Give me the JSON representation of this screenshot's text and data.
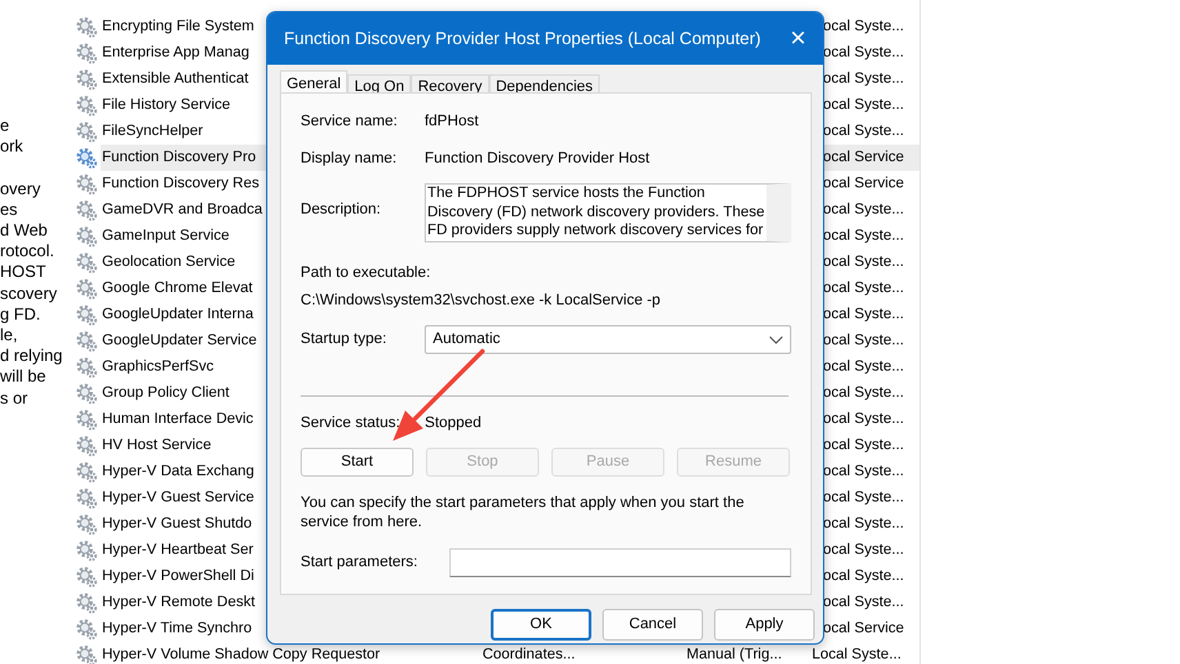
{
  "description_fragment": {
    "paragraphs": [
      [
        "e",
        "ork"
      ],
      [
        "overy",
        "es",
        "d Web",
        "rotocol.",
        "HOST",
        "scovery",
        "g FD.",
        "le,",
        "d relying",
        "will be",
        "s or"
      ]
    ]
  },
  "services": [
    {
      "name": "Encrypting File System",
      "log_on": "ocal Syste...",
      "selected": false
    },
    {
      "name": "Enterprise App Manag",
      "log_on": "ocal Syste...",
      "selected": false
    },
    {
      "name": "Extensible Authenticat",
      "log_on": "ocal Syste...",
      "selected": false
    },
    {
      "name": "File History Service",
      "log_on": "ocal Syste...",
      "selected": false
    },
    {
      "name": "FileSyncHelper",
      "log_on": "ocal Syste...",
      "selected": false
    },
    {
      "name": "Function Discovery Pro",
      "log_on": "ocal Service",
      "selected": true
    },
    {
      "name": "Function Discovery Res",
      "log_on": "ocal Service",
      "selected": false
    },
    {
      "name": "GameDVR and Broadca",
      "log_on": "ocal Syste...",
      "selected": false
    },
    {
      "name": "GameInput Service",
      "log_on": "ocal Syste...",
      "selected": false
    },
    {
      "name": "Geolocation Service",
      "log_on": "ocal Syste...",
      "selected": false
    },
    {
      "name": "Google Chrome Elevat",
      "log_on": "ocal Syste...",
      "selected": false
    },
    {
      "name": "GoogleUpdater Interna",
      "log_on": "ocal Syste...",
      "selected": false
    },
    {
      "name": "GoogleUpdater Service",
      "log_on": "ocal Syste...",
      "selected": false
    },
    {
      "name": "GraphicsPerfSvc",
      "log_on": "ocal Syste...",
      "selected": false
    },
    {
      "name": "Group Policy Client",
      "log_on": "ocal Syste...",
      "selected": false
    },
    {
      "name": "Human Interface Devic",
      "log_on": "ocal Syste...",
      "selected": false
    },
    {
      "name": "HV Host Service",
      "log_on": "ocal Syste...",
      "selected": false
    },
    {
      "name": "Hyper-V Data Exchang",
      "log_on": "ocal Syste...",
      "selected": false
    },
    {
      "name": "Hyper-V Guest Service",
      "log_on": "ocal Syste...",
      "selected": false
    },
    {
      "name": "Hyper-V Guest Shutdo",
      "log_on": "ocal Syste...",
      "selected": false
    },
    {
      "name": "Hyper-V Heartbeat Ser",
      "log_on": "ocal Syste...",
      "selected": false
    },
    {
      "name": "Hyper-V PowerShell Di",
      "log_on": "ocal Syste...",
      "selected": false
    },
    {
      "name": "Hyper-V Remote Deskt",
      "log_on": "ocal Syste...",
      "selected": false
    },
    {
      "name": "Hyper-V Time Synchro",
      "log_on": "ocal Service",
      "selected": false
    },
    {
      "name": "Hyper-V Volume Shadow Copy Requestor",
      "description": "Coordinates...",
      "startup_type": "Manual (Trig...",
      "log_on": "Local Syste...",
      "selected": false
    }
  ],
  "dialog": {
    "title": "Function Discovery Provider Host Properties (Local Computer)",
    "close": "×",
    "tabs": [
      {
        "label": "General",
        "selected": true
      },
      {
        "label": "Log On",
        "selected": false
      },
      {
        "label": "Recovery",
        "selected": false
      },
      {
        "label": "Dependencies",
        "selected": false
      }
    ],
    "service_name": {
      "label": "Service name:",
      "value": "fdPHost"
    },
    "display_name": {
      "label": "Display name:",
      "value": "Function Discovery Provider Host"
    },
    "description": {
      "label": "Description:",
      "lines": [
        "The FDPHOST service hosts the Function",
        "Discovery (FD) network discovery providers. These",
        "FD providers supply network discovery services for"
      ]
    },
    "path": {
      "label": "Path to executable:",
      "value": "C:\\Windows\\system32\\svchost.exe -k LocalService -p"
    },
    "startup_type": {
      "label": "Startup type:",
      "value": "Automatic"
    },
    "service_status": {
      "label": "Service status:",
      "value": "Stopped"
    },
    "control_buttons": [
      {
        "label": "Start",
        "disabled": false
      },
      {
        "label": "Stop",
        "disabled": true
      },
      {
        "label": "Pause",
        "disabled": true
      },
      {
        "label": "Resume",
        "disabled": true
      }
    ],
    "hint": "You can specify the start parameters that apply when you start the service from here.",
    "start_parameters": {
      "label": "Start parameters:"
    },
    "buttons": [
      {
        "label": "OK",
        "default": true
      },
      {
        "label": "Cancel",
        "default": false
      },
      {
        "label": "Apply",
        "default": false
      }
    ]
  }
}
